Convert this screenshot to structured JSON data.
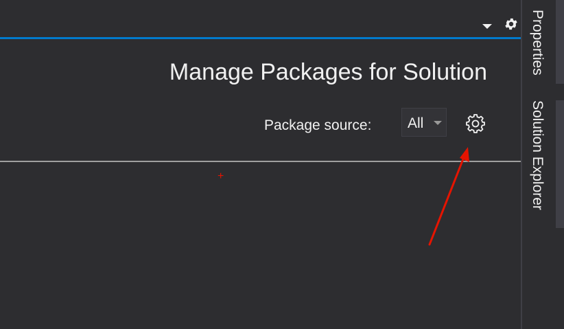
{
  "header": {
    "title": "Manage Packages for Solution"
  },
  "package_source": {
    "label": "Package source:",
    "selected": "All"
  },
  "dock": {
    "tabs": [
      {
        "label": "Properties"
      },
      {
        "label": "Solution Explorer"
      }
    ]
  },
  "annotation": {
    "marker": "+"
  },
  "colors": {
    "background": "#2d2d30",
    "accent": "#007acc",
    "text": "#f1f1f1",
    "annotation": "#e51400"
  },
  "icons": {
    "top_dropdown": "chevron-down-icon",
    "top_settings": "gear-icon",
    "package_settings": "gear-icon",
    "select_caret": "caret-down-icon",
    "annotation_arrow": "arrow-icon"
  }
}
